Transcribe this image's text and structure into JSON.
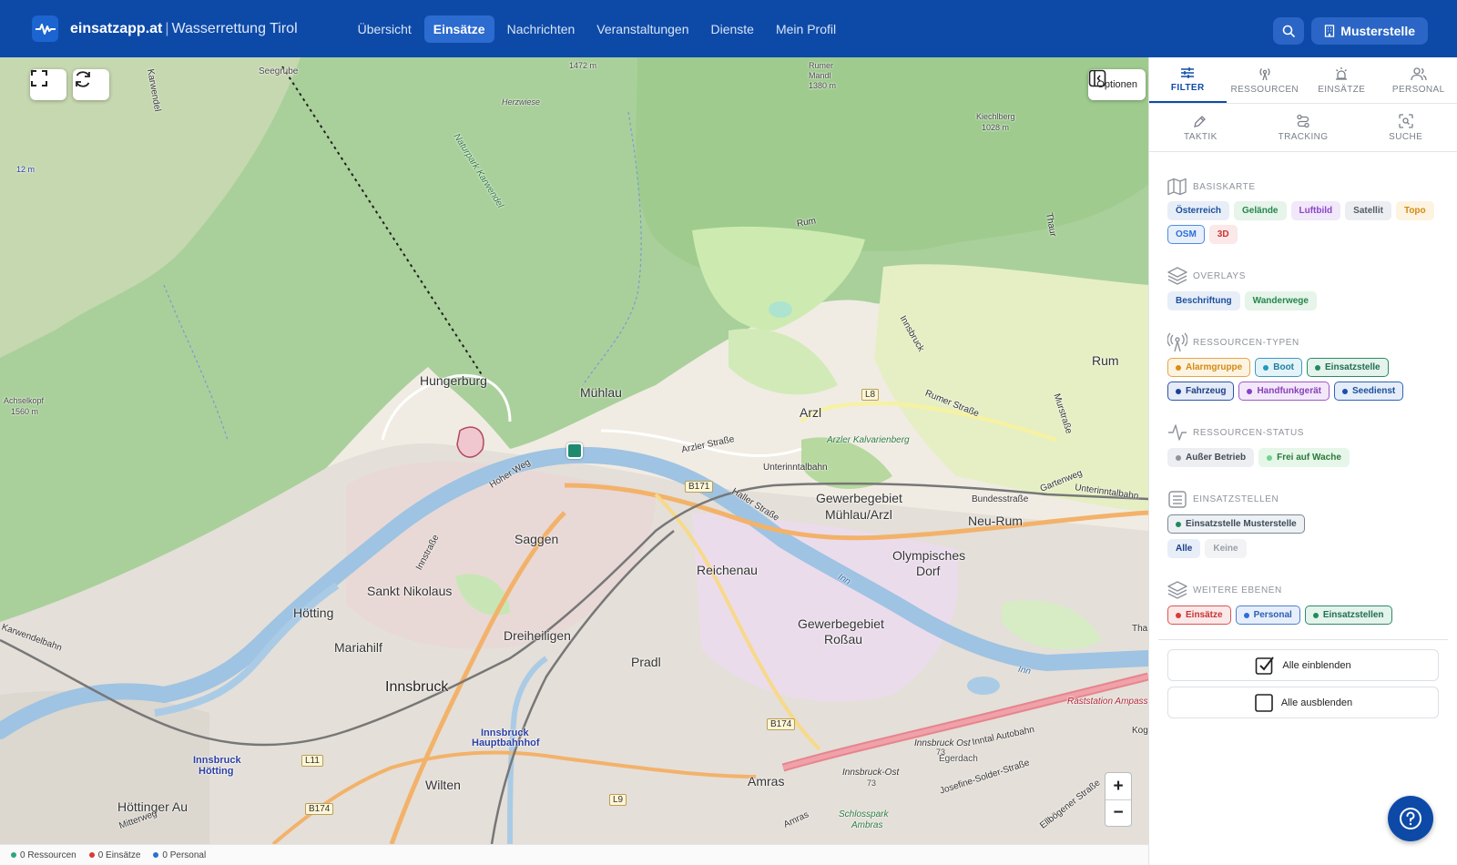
{
  "brand": {
    "name": "einsatzapp.at",
    "separator": "|",
    "org": "Wasserrettung Tirol"
  },
  "nav": {
    "items": [
      {
        "label": "Übersicht",
        "active": false
      },
      {
        "label": "Einsätze",
        "active": true
      },
      {
        "label": "Nachrichten",
        "active": false
      },
      {
        "label": "Veranstaltungen",
        "active": false
      },
      {
        "label": "Dienste",
        "active": false
      },
      {
        "label": "Mein Profil",
        "active": false
      }
    ]
  },
  "account": {
    "label": "Musterstelle"
  },
  "map": {
    "options_label": "Optionen",
    "zoom_in": "+",
    "zoom_out": "−",
    "labels": {
      "seegrube": "Seegrube",
      "rumer_mandl": "Rumer\nMandl\n1380 m",
      "rumer_mandl_1": "Rumer",
      "rumer_mandl_2": "Mandl",
      "rumer_mandl_3": "1380 m",
      "kiechlberg_1": "Kiechlberg",
      "kiechlberg_2": "1028 m",
      "herzwiese": "Herzwiese",
      "naturpark": "Naturpark Karwendel",
      "hoehe_12": "12 m",
      "hoehe_1472": "1472 m",
      "achselkopf_1": "Achselkopf",
      "achselkopf_2": "1560 m",
      "hungerburg": "Hungerburg",
      "muehlau": "Mühlau",
      "arzl": "Arzl",
      "arzler_strasse": "Arzler Straße",
      "arzler_kalvarienberg": "Arzler Kalvarienberg",
      "unterinntalbahn": "Unterinntalbahn",
      "rumer_strasse": "Rumer Straße",
      "rum": "Rum",
      "murstrasse": "Murstraße",
      "innsbruck_street": "Innsbruck",
      "gewerbe_muehlau_1": "Gewerbegebiet",
      "gewerbe_muehlau_2": "Mühlau/Arzl",
      "bundesstrasse": "Bundesstraße",
      "gartenweg": "Gartenweg",
      "neu_rum": "Neu-Rum",
      "olympisches_dorf_1": "Olympisches",
      "olympisches_dorf_2": "Dorf",
      "saggen": "Saggen",
      "reichenau": "Reichenau",
      "haller_strasse": "Haller Straße",
      "hoher_weg": "Hoher Weg",
      "sankt_nikolaus": "Sankt Nikolaus",
      "hoetting": "Hötting",
      "mariahilf": "Mariahilf",
      "dreiheiligen": "Dreiheiligen",
      "pradl": "Pradl",
      "gewerbe_rossau_1": "Gewerbegebiet",
      "gewerbe_rossau_2": "Roßau",
      "innsbruck": "Innsbruck",
      "hbf_1": "Innsbruck",
      "hbf_2": "Hauptbahnhof",
      "hoetting_st_1": "Innsbruck",
      "hoetting_st_2": "Hötting",
      "wilten": "Wilten",
      "hoettinger_au": "Höttinger Au",
      "amras": "Amras",
      "egerdach": "Egerdach",
      "raststation": "Raststation Ampass",
      "inntal_autobahn": "Inntal Autobahn",
      "innsbruck_ost": "Innsbruck Ost",
      "innsbruck_ost_2": "Innsbruck-Ost",
      "josefine": "Josefine-Solder-Straße",
      "ellboegener": "Ellbögener Straße",
      "schlosspark_1": "Schlosspark",
      "schlosspark_2": "Ambras",
      "inn_1": "Inn",
      "inn_2": "Inn",
      "innstrasse": "Innstraße",
      "karwendelbahn": "Karwendelbahn",
      "karwendel": "Karwendel",
      "mitterweg": "Mitterweg",
      "rum_road": "Rum",
      "thaur": "Thaur",
      "tha": "Tha",
      "kog": "Kog",
      "unterinntalbahn2": "Unterinntalbahn",
      "amras_road": "Amras",
      "hoehe_73": "73",
      "hoehe_73b": "73"
    },
    "shields": {
      "b171": "B171",
      "l8": "L8",
      "b174": "B174",
      "b174b": "B174",
      "l11": "L11",
      "l9": "L9"
    }
  },
  "status": {
    "resources": "0 Ressourcen",
    "incidents": "0 Einsätze",
    "personnel": "0 Personal",
    "colors": {
      "resources": "#2aa87a",
      "incidents": "#d83a3a",
      "personnel": "#2b6fd6"
    }
  },
  "panel": {
    "tabs_row1": [
      {
        "label": "FILTER",
        "icon": "sliders-icon",
        "active": true
      },
      {
        "label": "RESSOURCEN",
        "icon": "radio-tower-icon",
        "active": false
      },
      {
        "label": "EINSÄTZE",
        "icon": "siren-icon",
        "active": false
      },
      {
        "label": "PERSONAL",
        "icon": "people-icon",
        "active": false
      }
    ],
    "tabs_row2": [
      {
        "label": "TAKTIK",
        "icon": "pen-icon",
        "active": false
      },
      {
        "label": "TRACKING",
        "icon": "route-icon",
        "active": false
      },
      {
        "label": "SUCHE",
        "icon": "scan-search-icon",
        "active": false
      }
    ],
    "sections": {
      "basiskarte": {
        "title": "BASISKARTE",
        "chips": [
          {
            "label": "Österreich",
            "color": "#1b4f9c",
            "bg": "#e8eef8",
            "border": "#e8eef8"
          },
          {
            "label": "Gelände",
            "color": "#25864d",
            "bg": "#e6f4ea",
            "border": "#e6f4ea"
          },
          {
            "label": "Luftbild",
            "color": "#8a45c8",
            "bg": "#f1e8fa",
            "border": "#f1e8fa"
          },
          {
            "label": "Satellit",
            "color": "#555c66",
            "bg": "#eceef1",
            "border": "#eceef1"
          },
          {
            "label": "Topo",
            "color": "#d48a12",
            "bg": "#fdf3e1",
            "border": "#fdf3e1"
          },
          {
            "label": "OSM",
            "color": "#2b6fd6",
            "bg": "#e7effb",
            "border": "#4f8be0"
          },
          {
            "label": "3D",
            "color": "#c93333",
            "bg": "#fbe8e8",
            "border": "#fbe8e8"
          }
        ]
      },
      "overlays": {
        "title": "OVERLAYS",
        "chips": [
          {
            "label": "Beschriftung",
            "color": "#1b4f9c",
            "bg": "#e8eef8",
            "border": "#e8eef8"
          },
          {
            "label": "Wanderwege",
            "color": "#25864d",
            "bg": "#e6f4ea",
            "border": "#e6f4ea"
          }
        ]
      },
      "ressourcen_typen": {
        "title": "RESSOURCEN-TYPEN",
        "chips": [
          {
            "label": "Alarmgruppe",
            "color": "#d48a12",
            "bg": "#fdf3e1",
            "border": "#e3a64a",
            "dot": "#e08a12"
          },
          {
            "label": "Boot",
            "color": "#1d7fa0",
            "bg": "#e4f3f8",
            "border": "#3a9ac0",
            "dot": "#1d9ac0"
          },
          {
            "label": "Einsatzstelle",
            "color": "#1f6e55",
            "bg": "#e4f3ec",
            "border": "#2e8a68",
            "dot": "#1f8a60"
          },
          {
            "label": "Fahrzeug",
            "color": "#1b3f88",
            "bg": "#e5ebf7",
            "border": "#2e54a8",
            "dot": "#1b3f98"
          },
          {
            "label": "Handfunkgerät",
            "color": "#8a3fb8",
            "bg": "#f2e8f9",
            "border": "#9d5ac8",
            "dot": "#8a3fc8"
          },
          {
            "label": "Seedienst",
            "color": "#1b4f9c",
            "bg": "#e5edf8",
            "border": "#2e64b8",
            "dot": "#1b4fb0"
          }
        ]
      },
      "ressourcen_status": {
        "title": "RESSOURCEN-STATUS",
        "chips": [
          {
            "label": "Außer Betrieb",
            "color": "#444b55",
            "bg": "#eceef1",
            "border": "#eceef1",
            "dot": "#8d929b"
          },
          {
            "label": "Frei auf Wache",
            "color": "#2a7a3a",
            "bg": "#e6f6e9",
            "border": "#e6f6e9",
            "dot": "#6fd48a"
          }
        ]
      },
      "einsatzstellen": {
        "title": "EINSATZSTELLEN",
        "chips": [
          {
            "label": "Einsatzstelle Musterstelle",
            "color": "#3a4a5a",
            "bg": "#eef1f4",
            "border": "#7a8796",
            "dot": "#1f8a60"
          }
        ],
        "sub_chips": [
          {
            "label": "Alle",
            "color": "#1b3f88",
            "bg": "#e8eef8",
            "border": "#e8eef8"
          },
          {
            "label": "Keine",
            "color": "#9aa0a8",
            "bg": "#f2f3f5",
            "border": "#f2f3f5"
          }
        ]
      },
      "weitere_ebenen": {
        "title": "WEITERE EBENEN",
        "chips": [
          {
            "label": "Einsätze",
            "color": "#c93333",
            "bg": "#fbe8e8",
            "border": "#d95555",
            "dot": "#d83a3a"
          },
          {
            "label": "Personal",
            "color": "#2b5fb0",
            "bg": "#e7eefb",
            "border": "#4f7fd0",
            "dot": "#2b6fd6"
          },
          {
            "label": "Einsatzstellen",
            "color": "#1f6e55",
            "bg": "#e4f3ec",
            "border": "#2e8a68",
            "dot": "#1f8a60"
          }
        ]
      }
    },
    "actions": {
      "show_all": "Alle einblenden",
      "hide_all": "Alle ausblenden"
    }
  }
}
